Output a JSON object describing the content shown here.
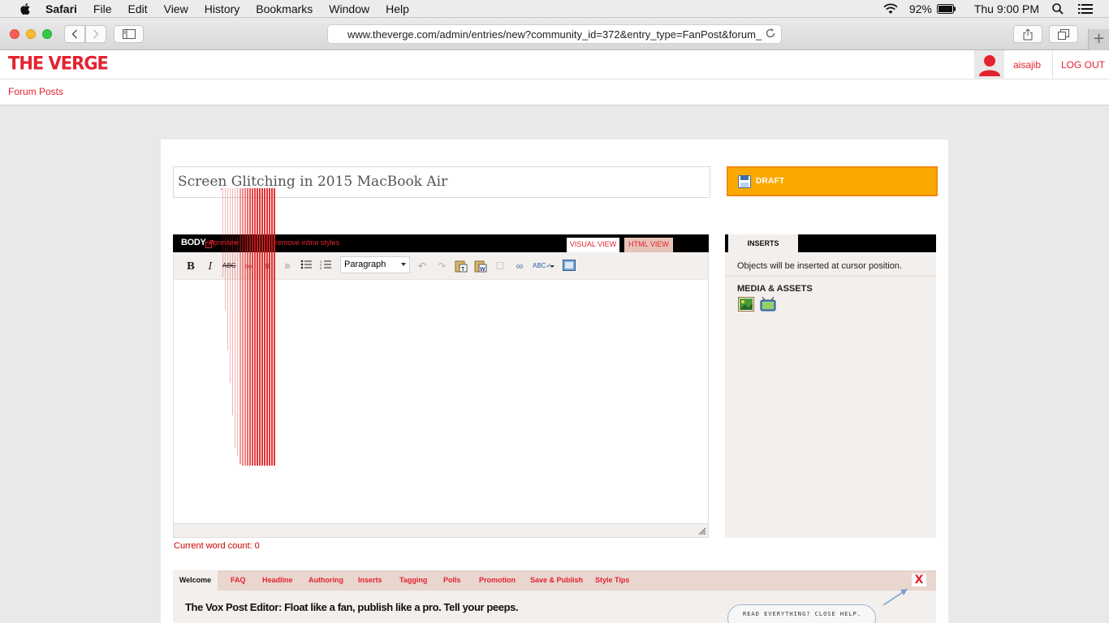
{
  "menubar": {
    "apple_icon": "apple-logo-icon",
    "app_name": "Safari",
    "items": [
      "File",
      "Edit",
      "View",
      "History",
      "Bookmarks",
      "Window",
      "Help"
    ],
    "battery": "92%",
    "clock": "Thu 9:00 PM"
  },
  "browser": {
    "url": "www.theverge.com/admin/entries/new?community_id=372&entry_type=FanPost&forum_"
  },
  "site": {
    "logo": "THE VERGE",
    "brand_color": "#e5222f",
    "username": "aisajib",
    "logout": "LOG OUT",
    "nav_link": "Forum Posts"
  },
  "editor": {
    "title_value": "Screen Glitching in 2015 MacBook Air",
    "draft_label": "DRAFT",
    "draft_color": "#fba900",
    "body_label": "BODY",
    "preview_link": "preview",
    "remove_styles_link": "remove inline styles",
    "tabs": {
      "visual": "VISUAL VIEW",
      "html": "HTML VIEW"
    },
    "format_select": "Paragraph",
    "word_count": "Current word count: 0"
  },
  "inserts": {
    "tab": "INSERTS",
    "note": "Objects will be inserted at cursor position.",
    "media_heading": "MEDIA & ASSETS"
  },
  "help": {
    "tabs": [
      "Welcome",
      "FAQ",
      "Headline",
      "Authoring",
      "Inserts",
      "Tagging",
      "Polls",
      "Promotion",
      "Save & Publish",
      "Style Tips"
    ],
    "close": "X",
    "title": "The Vox Post Editor: Float like a fan, publish like a pro. Tell your peeps.",
    "bubble_text": "READ EVERYTHING? CLOSE HELP."
  }
}
